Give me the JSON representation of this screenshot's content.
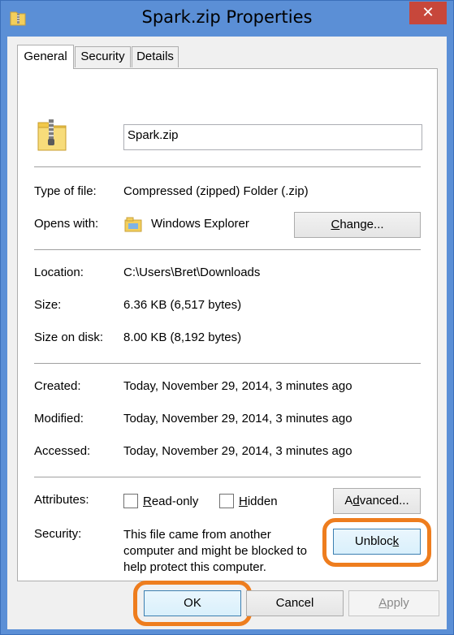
{
  "window": {
    "title": "Spark.zip Properties",
    "close_label": "✕"
  },
  "tabs": [
    {
      "label": "General",
      "active": true
    },
    {
      "label": "Security",
      "active": false
    },
    {
      "label": "Details",
      "active": false
    }
  ],
  "general": {
    "file_name": "Spark.zip",
    "type_label": "Type of file:",
    "type_value": "Compressed (zipped) Folder (.zip)",
    "opens_label": "Opens with:",
    "opens_value": "Windows Explorer",
    "change_button": {
      "pre": "",
      "key": "C",
      "post": "hange..."
    },
    "location_label": "Location:",
    "location_value": "C:\\Users\\Bret\\Downloads",
    "size_label": "Size:",
    "size_value": "6.36 KB (6,517 bytes)",
    "size_disk_label": "Size on disk:",
    "size_disk_value": "8.00 KB (8,192 bytes)",
    "created_label": "Created:",
    "created_value": "Today, November 29, 2014, 3 minutes ago",
    "modified_label": "Modified:",
    "modified_value": "Today, November 29, 2014, 3 minutes ago",
    "accessed_label": "Accessed:",
    "accessed_value": "Today, November 29, 2014, 3 minutes ago",
    "attributes_label": "Attributes:",
    "readonly": {
      "pre": "",
      "key": "R",
      "post": "ead-only",
      "checked": false
    },
    "hidden": {
      "pre": "",
      "key": "H",
      "post": "idden",
      "checked": false
    },
    "advanced_button": {
      "pre": "A",
      "key": "d",
      "post": "vanced..."
    },
    "security_label": "Security:",
    "security_text_1": "This file came from another",
    "security_text_2": "computer and might be blocked to",
    "security_text_3": "help protect this computer.",
    "unblock_button": {
      "pre": "Unbloc",
      "key": "k",
      "post": ""
    }
  },
  "footer": {
    "ok": "OK",
    "cancel": "Cancel",
    "apply": {
      "pre": "",
      "key": "A",
      "post": "pply"
    }
  },
  "colors": {
    "window_frame": "#5b8fd6",
    "close_button": "#c7473b",
    "highlight": "#ee7d1e"
  },
  "icons": {
    "title": "zip-folder-icon",
    "file": "zip-folder-icon",
    "opens_with": "windows-explorer-icon"
  }
}
